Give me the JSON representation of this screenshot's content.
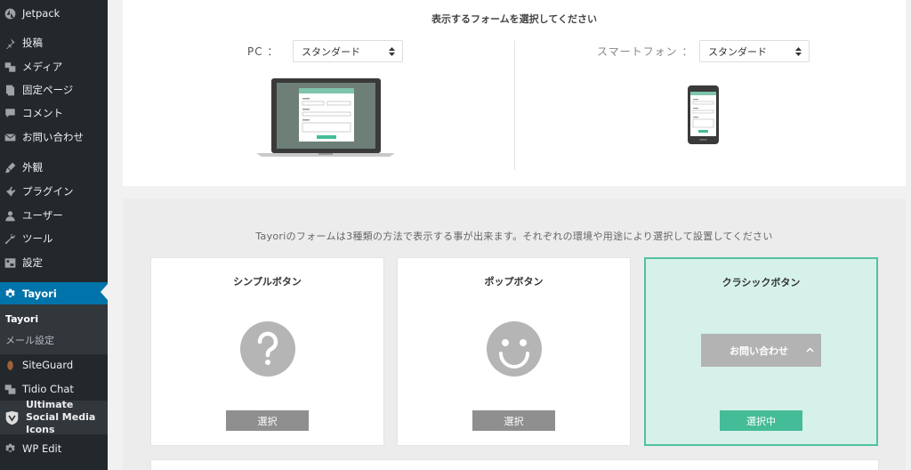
{
  "sidebar": {
    "items": [
      {
        "label": "Jetpack",
        "icon": "jetpack-icon"
      },
      {
        "label": "投稿",
        "icon": "pin-icon"
      },
      {
        "label": "メディア",
        "icon": "media-icon"
      },
      {
        "label": "固定ページ",
        "icon": "pages-icon"
      },
      {
        "label": "コメント",
        "icon": "comment-icon"
      },
      {
        "label": "お問い合わせ",
        "icon": "mail-icon"
      },
      {
        "label": "外観",
        "icon": "brush-icon"
      },
      {
        "label": "プラグイン",
        "icon": "plugin-icon"
      },
      {
        "label": "ユーザー",
        "icon": "user-icon"
      },
      {
        "label": "ツール",
        "icon": "wrench-icon"
      },
      {
        "label": "設定",
        "icon": "settings-icon"
      },
      {
        "label": "Tayori",
        "icon": "gear-icon"
      },
      {
        "label": "SiteGuard",
        "icon": "siteguard-icon"
      },
      {
        "label": "Tidio Chat",
        "icon": "chat-icon"
      },
      {
        "label": "Ultimate Social Media Icons",
        "icon": "social-icon"
      },
      {
        "label": "WP Edit",
        "icon": "gear-icon"
      }
    ],
    "submenu": {
      "current": "Tayori",
      "mail_settings": "メール設定"
    },
    "colors": {
      "bg": "#23282d",
      "active": "#0073aa",
      "submenu_bg": "#32373c"
    }
  },
  "top_panel": {
    "title": "表示するフォームを選択してください",
    "pc_label": "PC ：",
    "pc_select": "スタンダード",
    "sp_label": "スマートフォン ：",
    "sp_select": "スタンダード"
  },
  "bottom_panel": {
    "description": "Tayoriのフォームは3種類の方法で表示する事が出来ます。それぞれの環境や用途により選択して設置してください",
    "cards": [
      {
        "title": "シンプルボタン",
        "button": "選択",
        "selected": false
      },
      {
        "title": "ポップボタン",
        "button": "選択",
        "selected": false
      },
      {
        "title": "クラシックボタン",
        "button": "選択中",
        "selected": true,
        "preview_label": "お問い合わせ"
      }
    ],
    "colors": {
      "accent": "#45bc98",
      "selected_bg": "#d6f1ea",
      "button_grey": "#8f8f8f"
    }
  }
}
